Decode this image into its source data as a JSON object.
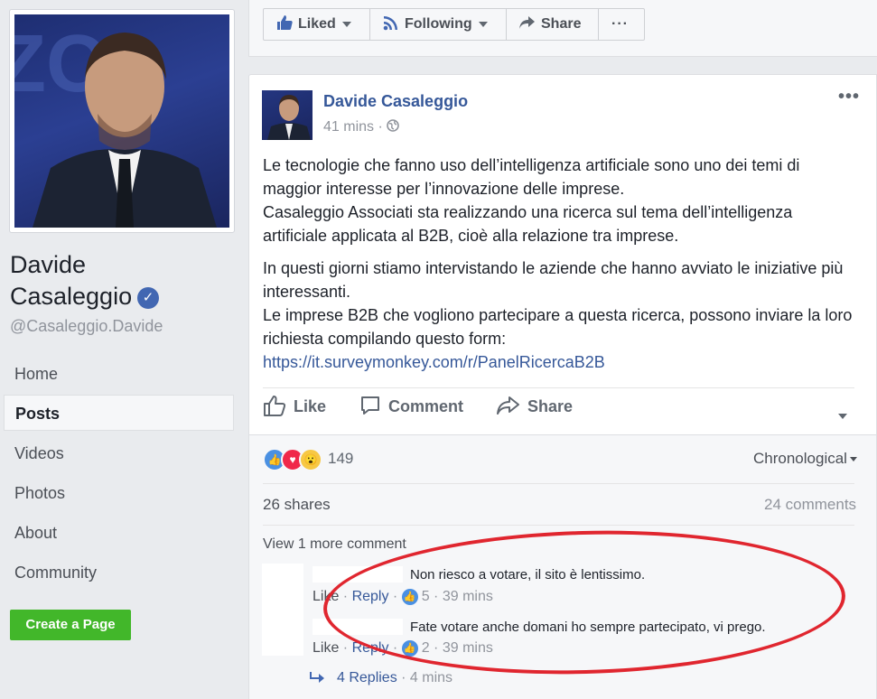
{
  "sidebar": {
    "page_name_first": "Davide",
    "page_name_last": "Casaleggio",
    "handle": "@Casaleggio.Davide",
    "nav": [
      "Home",
      "Posts",
      "Videos",
      "Photos",
      "About",
      "Community"
    ],
    "active_nav": "Posts",
    "create_page": "Create a Page"
  },
  "topbar": {
    "liked": "Liked",
    "following": "Following",
    "share": "Share",
    "more": "···"
  },
  "post": {
    "author": "Davide Casaleggio",
    "time": "41 mins",
    "privacy_icon": "globe-icon",
    "paragraph1_line1": "Le tecnologie che fanno uso dell’intelligenza artificiale sono uno dei temi di maggior interesse per l’innovazione delle imprese.",
    "paragraph1_line2": "Casaleggio Associati sta realizzando una ricerca sul tema dell’intelligenza artificiale applicata al B2B, cioè alla relazione tra imprese.",
    "paragraph2_line1": "In questi giorni stiamo intervistando le aziende che hanno avviato le iniziative più interessanti.",
    "paragraph2_line2": "Le imprese B2B che vogliono partecipare a questa ricerca, possono inviare la loro richiesta compilando questo form:",
    "link": "https://it.surveymonkey.com/r/PanelRicercaB2B",
    "actions": {
      "like": "Like",
      "comment": "Comment",
      "share": "Share"
    }
  },
  "stats": {
    "reaction_icons": [
      "like-reaction-icon",
      "love-reaction-icon",
      "wow-reaction-icon"
    ],
    "reaction_count": "149",
    "sort": "Chronological",
    "shares": "26 shares",
    "comments": "24 comments",
    "view_more": "View 1 more comment"
  },
  "comments": [
    {
      "text": "Non riesco a votare, il sito è lentissimo.",
      "like": "Like",
      "reply": "Reply",
      "likes": "5",
      "time": "39 mins"
    },
    {
      "text": "Fate votare anche domani ho sempre partecipato, vi prego.",
      "like": "Like",
      "reply": "Reply",
      "likes": "2",
      "time": "39 mins"
    }
  ],
  "replies": {
    "label": "4 Replies",
    "time": "4 mins"
  },
  "colors": {
    "link": "#365899",
    "highlight_ellipse": "#e0262f",
    "create_button": "#42b72a"
  }
}
